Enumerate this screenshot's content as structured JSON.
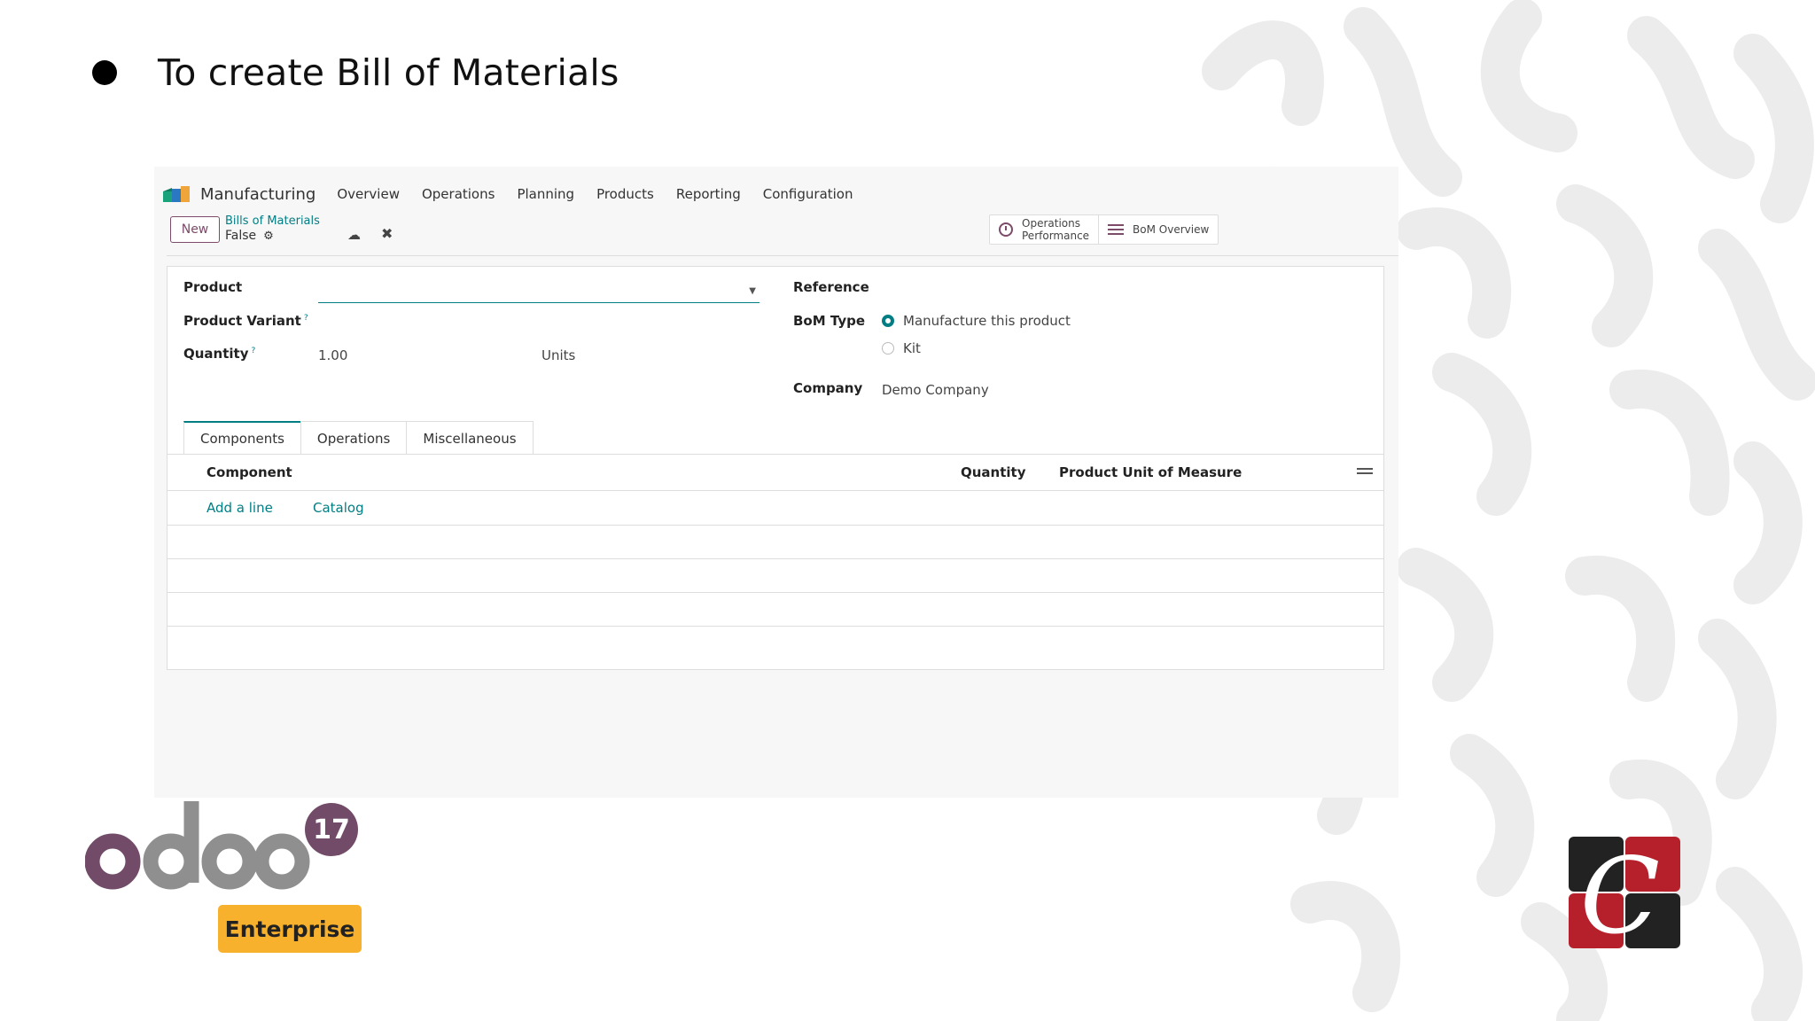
{
  "slide": {
    "title": "To create Bill of Materials"
  },
  "app": {
    "name": "Manufacturing",
    "nav": [
      "Overview",
      "Operations",
      "Planning",
      "Products",
      "Reporting",
      "Configuration"
    ]
  },
  "control_panel": {
    "new_label": "New",
    "breadcrumb": "Bills of Materials",
    "record_name": "False",
    "smart_buttons": {
      "ops_line1": "Operations",
      "ops_line2": "Performance",
      "bom_overview": "BoM Overview"
    }
  },
  "form": {
    "product_label": "Product",
    "product_value": "",
    "variant_label": "Product Variant",
    "variant_help": "?",
    "quantity_label": "Quantity",
    "quantity_help": "?",
    "quantity_value": "1.00",
    "uom_value": "Units",
    "reference_label": "Reference",
    "bom_type_label": "BoM Type",
    "bom_type_options": [
      "Manufacture this product",
      "Kit"
    ],
    "bom_type_selected": "Manufacture this product",
    "company_label": "Company",
    "company_value": "Demo Company"
  },
  "tabs": [
    "Components",
    "Operations",
    "Miscellaneous"
  ],
  "active_tab": "Components",
  "components_table": {
    "headers": {
      "component": "Component",
      "quantity": "Quantity",
      "uom": "Product Unit of Measure"
    },
    "add_line": "Add a line",
    "catalog": "Catalog"
  },
  "branding": {
    "odoo_word": "odoo",
    "version": "17",
    "edition": "Enterprise"
  },
  "colors": {
    "odoo_purple": "#714b67",
    "teal_accent": "#017e84",
    "edition_badge": "#f7b12c",
    "brand_red": "#b5202b",
    "brand_dark": "#222222"
  }
}
